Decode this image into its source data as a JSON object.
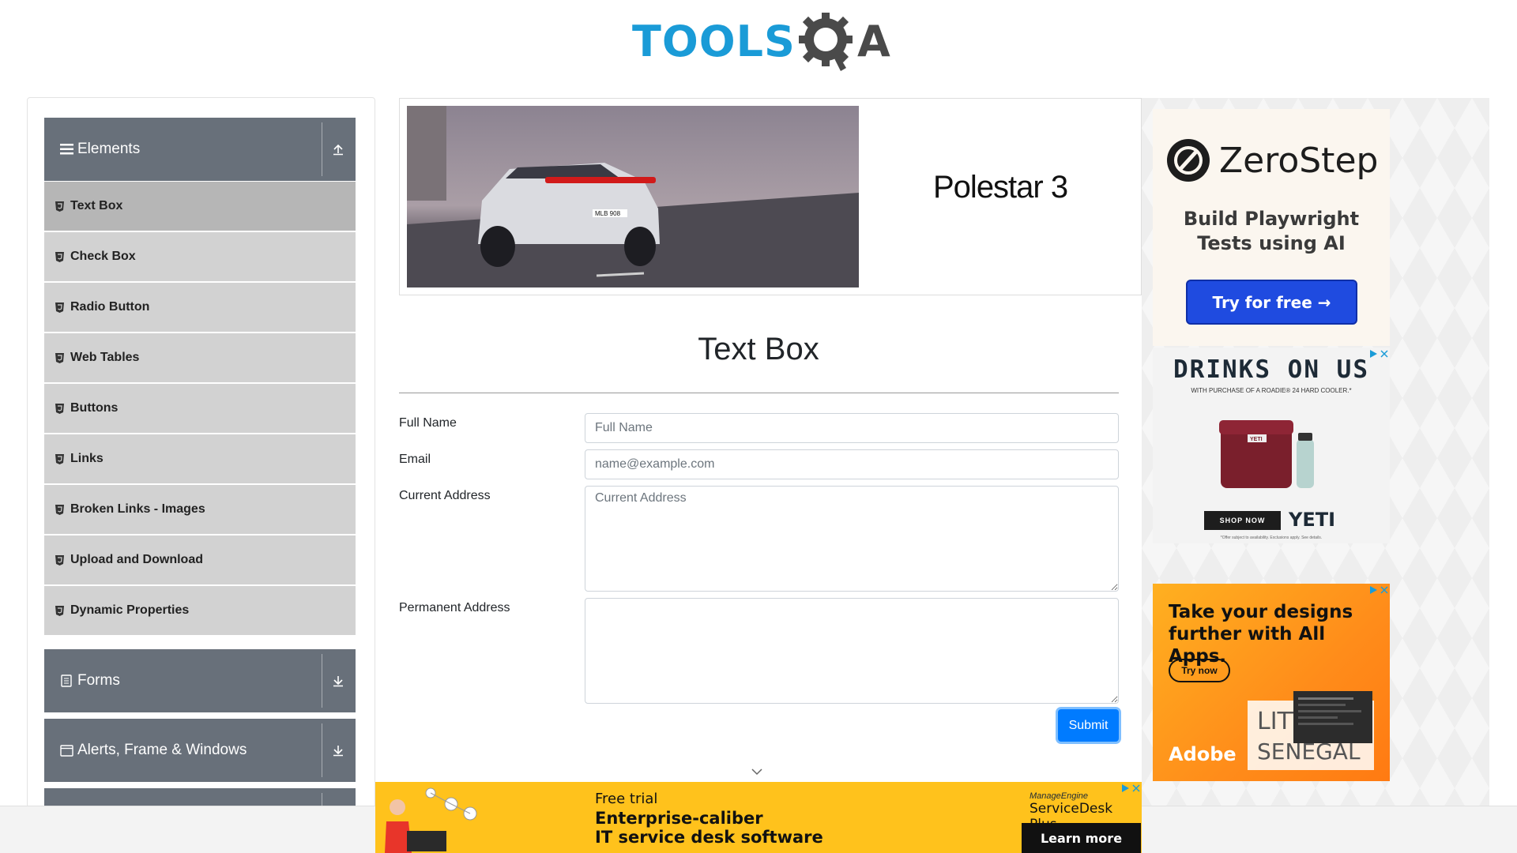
{
  "header": {
    "logo_part1": "TOOLS",
    "logo_part2": "A"
  },
  "sidebar": {
    "groups": [
      {
        "label": "Elements",
        "icon": "hamburger-icon",
        "expanded": true
      },
      {
        "label": "Forms",
        "icon": "document-icon",
        "expanded": false
      },
      {
        "label": "Alerts, Frame & Windows",
        "icon": "window-icon",
        "expanded": false
      }
    ],
    "elements_items": [
      {
        "label": "Text Box",
        "active": true
      },
      {
        "label": "Check Box"
      },
      {
        "label": "Radio Button"
      },
      {
        "label": "Web Tables"
      },
      {
        "label": "Buttons"
      },
      {
        "label": "Links"
      },
      {
        "label": "Broken Links - Images"
      },
      {
        "label": "Upload and Download"
      },
      {
        "label": "Dynamic Properties"
      }
    ]
  },
  "top_ad": {
    "brand": "Polestar 3",
    "plate": "MLB 908"
  },
  "main": {
    "title": "Text Box",
    "full_name_label": "Full Name",
    "full_name_placeholder": "Full Name",
    "full_name_value": "",
    "email_label": "Email",
    "email_placeholder": "name@example.com",
    "email_value": "",
    "current_address_label": "Current Address",
    "current_address_placeholder": "Current Address",
    "permanent_address_label": "Permanent Address",
    "submit_label": "Submit"
  },
  "right_ads": {
    "zerostep": {
      "brand": "ZeroStep",
      "tagline": "Build Playwright Tests using AI",
      "cta": "Try for free →"
    },
    "yeti": {
      "headline": "DRINKS ON US",
      "sub": "WITH PURCHASE OF A ROADIE® 24 HARD COOLER.*",
      "cooler_label": "YETI",
      "cta": "SHOP NOW",
      "brand": "YETI",
      "fine_print": "*Offer subject to availability. Exclusions apply. See details."
    },
    "adobe": {
      "headline": "Take your designs further with All Apps.",
      "cta": "Try now",
      "brand": "Adobe",
      "art_text1": "LITTI",
      "art_text2": "SENEGAL"
    }
  },
  "bottom_ad": {
    "small": "Free trial",
    "line1": "Enterprise-caliber",
    "line2": "IT service desk software",
    "brand_small": "ManageEngine",
    "brand": "ServiceDesk Plus",
    "cta": "Learn more"
  },
  "colors": {
    "logo_blue": "#1a9bd7",
    "logo_gray": "#4a4a4a",
    "sidebar_header": "#68707a",
    "menu_item": "#d2d2d2",
    "menu_active": "#b6b6b6",
    "submit": "#007bff"
  }
}
